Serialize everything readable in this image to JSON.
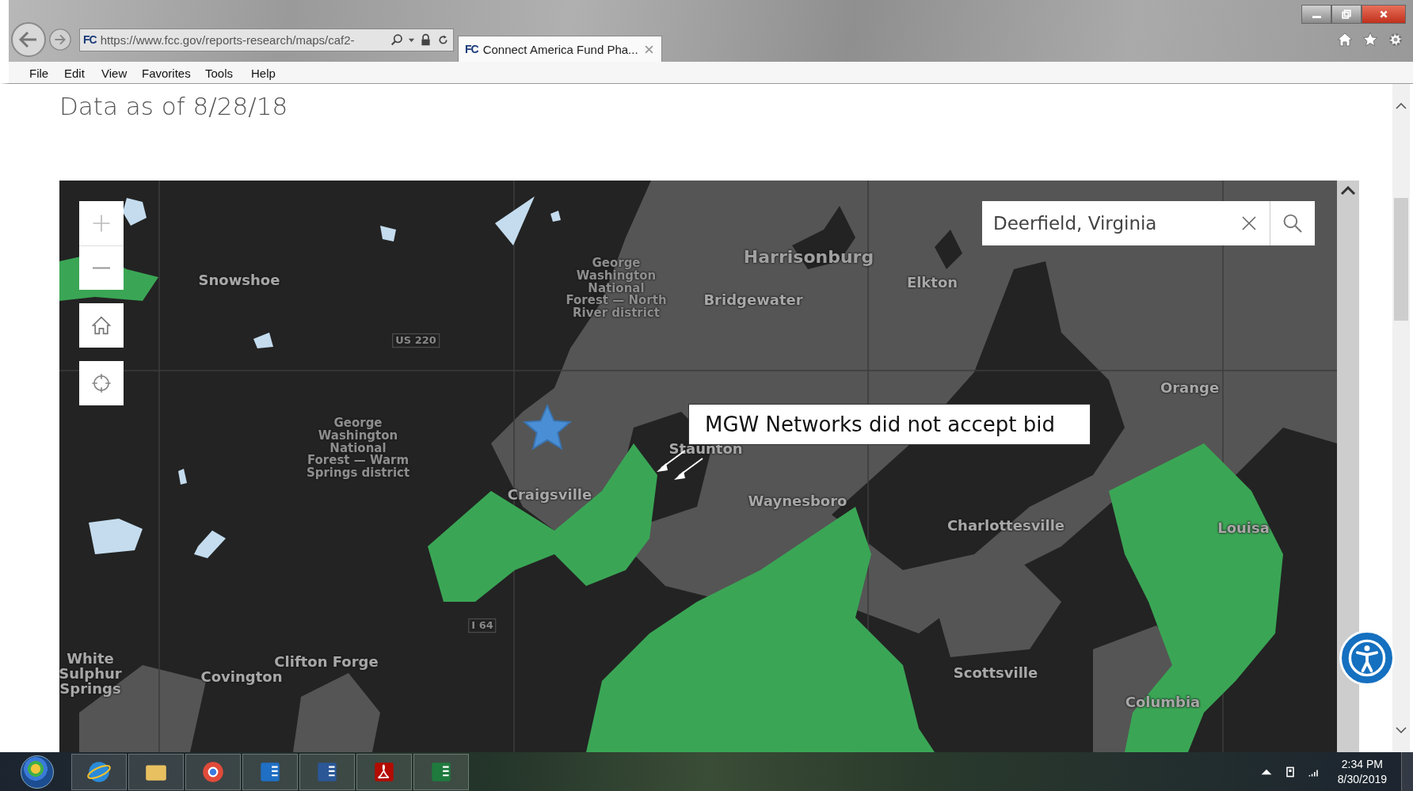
{
  "browser": {
    "address_bar": {
      "site_icon": "FC",
      "url": "https://www.fcc.gov/reports-research/maps/caf2-"
    },
    "tab": {
      "site_icon": "FC",
      "title": "Connect America Fund Pha...",
      "selected": true
    },
    "menu": [
      "File",
      "Edit",
      "View",
      "Favorites",
      "Tools",
      "Help"
    ]
  },
  "page": {
    "heading": "Data as of 8/28/18"
  },
  "map": {
    "search": {
      "value": "Deerfield, Virginia"
    },
    "callout": "MGW Networks did not accept bid",
    "labels": [
      {
        "kind": "city",
        "lines": [
          "Snowshoe"
        ]
      },
      {
        "kind": "road",
        "lines": [
          "US 220"
        ]
      },
      {
        "kind": "area",
        "lines": [
          "George",
          "Washington",
          "National",
          "Forest — North",
          "River district"
        ]
      },
      {
        "kind": "bigcity",
        "lines": [
          "Harrisonburg"
        ]
      },
      {
        "kind": "city",
        "lines": [
          "Bridgewater"
        ]
      },
      {
        "kind": "city",
        "lines": [
          "Elkton"
        ]
      },
      {
        "kind": "city",
        "lines": [
          "Orange"
        ]
      },
      {
        "kind": "city",
        "lines": [
          "Staunton"
        ]
      },
      {
        "kind": "city",
        "lines": [
          "Craigsville"
        ]
      },
      {
        "kind": "city",
        "lines": [
          "Waynesboro"
        ]
      },
      {
        "kind": "city",
        "lines": [
          "Charlottesville"
        ]
      },
      {
        "kind": "city",
        "lines": [
          "Louisa"
        ]
      },
      {
        "kind": "area",
        "lines": [
          "George",
          "Washington",
          "National",
          "Forest — Warm",
          "Springs district"
        ]
      },
      {
        "kind": "road",
        "lines": [
          "I 64"
        ]
      },
      {
        "kind": "city",
        "lines": [
          "White",
          "Sulphur",
          "Springs"
        ]
      },
      {
        "kind": "city",
        "lines": [
          "Covington"
        ]
      },
      {
        "kind": "city",
        "lines": [
          "Clifton Forge"
        ]
      },
      {
        "kind": "city",
        "lines": [
          "Scottsville"
        ]
      },
      {
        "kind": "city",
        "lines": [
          "Columbia"
        ]
      }
    ]
  },
  "taskbar": {
    "apps": [
      {
        "kind": "ie"
      },
      {
        "kind": "explorer"
      },
      {
        "kind": "chrome"
      },
      {
        "kind": "outlook"
      },
      {
        "kind": "word"
      },
      {
        "kind": "acrobat"
      },
      {
        "kind": "excel"
      }
    ],
    "time": "2:34 PM",
    "date": "8/30/2019"
  }
}
